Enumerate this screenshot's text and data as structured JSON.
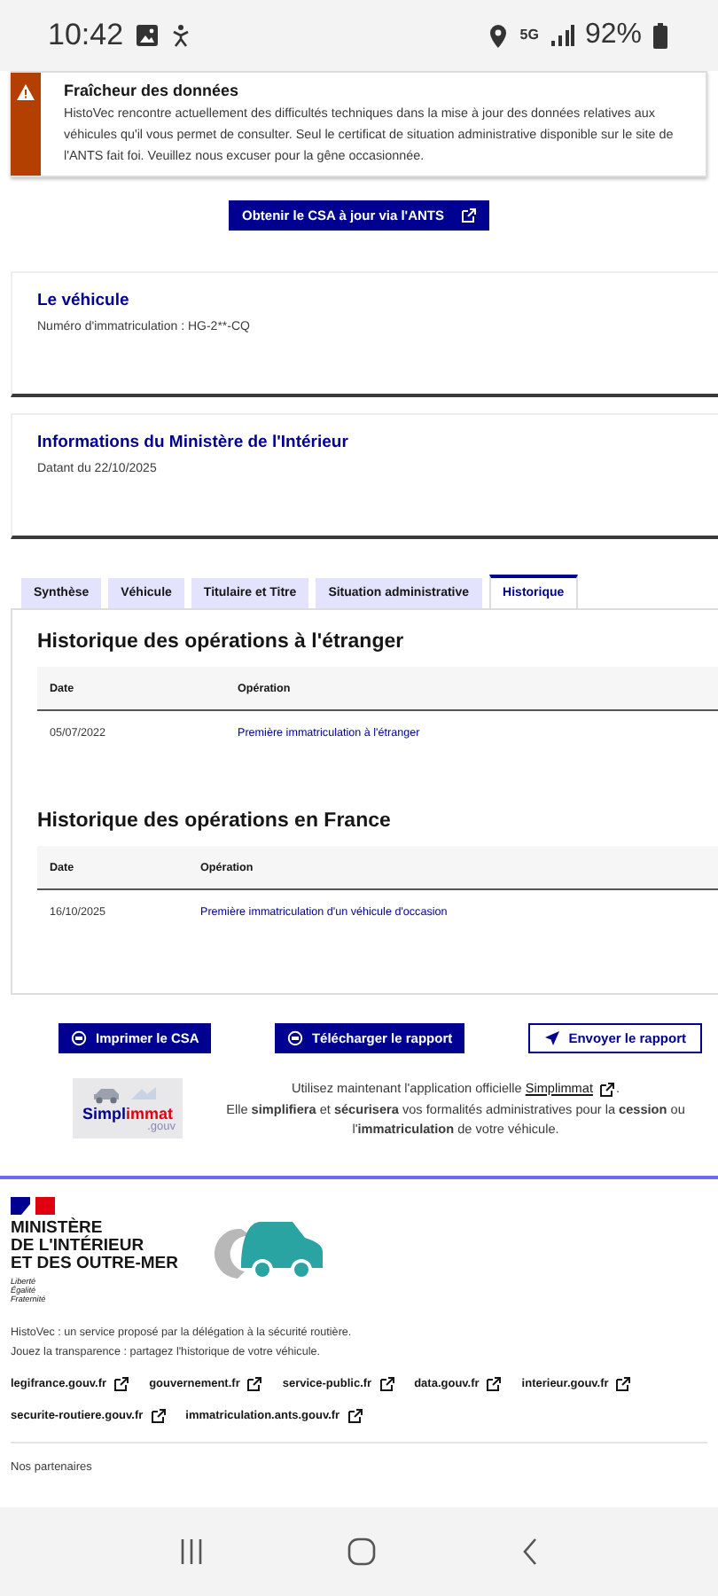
{
  "status_bar": {
    "time": "10:42",
    "network": "5G",
    "battery": "92%"
  },
  "alert": {
    "title": "Fraîcheur des données",
    "message": "HistoVec rencontre actuellement des difficultés techniques dans la mise à jour des données relatives aux véhicules qu'il vous permet de consulter. Seul le certificat de situation administrative disponible sur le site de l'ANTS fait foi. Veuillez nous excuser pour la gêne occasionnée."
  },
  "csa_button": "Obtenir le CSA à jour via l'ANTS",
  "cards": [
    {
      "title": "Le véhicule",
      "text": "Numéro d'immatriculation : HG-2**-CQ"
    },
    {
      "title": "Informations du Ministère de l'Intérieur",
      "text": "Datant du 22/10/2025"
    }
  ],
  "tabs": [
    {
      "label": "Synthèse",
      "selected": false
    },
    {
      "label": "Véhicule",
      "selected": false
    },
    {
      "label": "Titulaire et Titre",
      "selected": false
    },
    {
      "label": "Situation administrative",
      "selected": false
    },
    {
      "label": "Historique",
      "selected": true
    }
  ],
  "sections": [
    {
      "title": "Historique des opérations à l'étranger",
      "columns": [
        "Date",
        "Opération"
      ],
      "rows": [
        [
          "05/07/2022",
          "Première immatriculation à l'étranger"
        ]
      ]
    },
    {
      "title": "Historique des opérations en France",
      "columns": [
        "Date",
        "Opération"
      ],
      "rows": [
        [
          "16/10/2025",
          "Première immatriculation d'un véhicule d'occasion"
        ]
      ]
    }
  ],
  "actions": [
    {
      "label": "Imprimer le CSA",
      "kind": "print"
    },
    {
      "label": "Télécharger le rapport",
      "kind": "download"
    },
    {
      "label": "Envoyer le rapport",
      "kind": "send"
    }
  ],
  "promo": {
    "logo_name": "Simpl",
    "logo_highlight": "immat",
    "logo_suffix": ".gouv",
    "intro": "Utilisez maintenant l'application officielle ",
    "link": "Simplimmat",
    "end": ".",
    "text": "Elle **simplifiera** et **sécurisera** vos formalités administratives pour la **cession** ou l'**immatriculation** de votre véhicule."
  },
  "footer": {
    "ministry": [
      "MINISTÈRE",
      "DE L'INTÉRIEUR",
      "ET DES OUTRE-MER"
    ],
    "motto": [
      "Liberté",
      "Égalité",
      "Fraternité"
    ],
    "description": [
      "HistoVec : un service proposé par la délégation à la sécurité routière.",
      "Jouez la transparence : partagez l'historique de votre véhicule."
    ],
    "links": [
      "legifrance.gouv.fr",
      "gouvernement.fr",
      "service-public.fr",
      "data.gouv.fr",
      "interieur.gouv.fr",
      "securite-routiere.gouv.fr",
      "immatriculation.ants.gouv.fr"
    ],
    "partners_label": "Nos partenaires"
  }
}
